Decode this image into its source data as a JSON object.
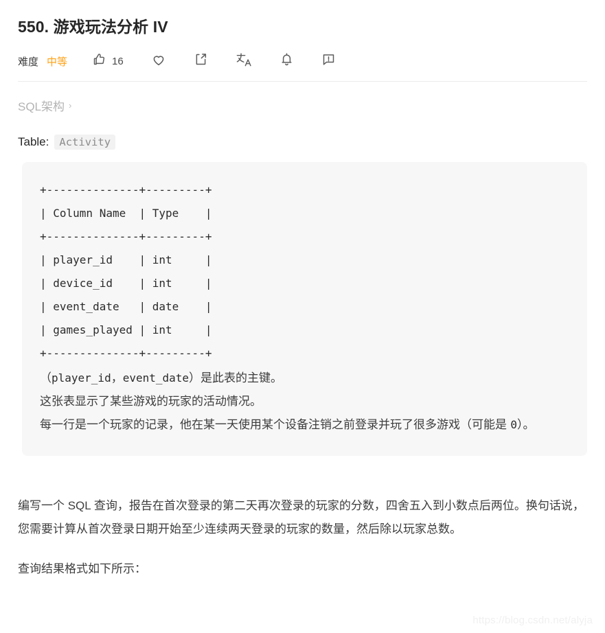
{
  "header": {
    "title": "550. 游戏玩法分析 IV",
    "difficulty_label": "难度",
    "difficulty_value": "中等",
    "difficulty_color": "#ffa116",
    "actions": [
      {
        "name": "like",
        "icon": "thumbs-up-icon",
        "count": "16"
      },
      {
        "name": "favorite",
        "icon": "heart-icon",
        "count": ""
      },
      {
        "name": "share",
        "icon": "share-icon",
        "count": ""
      },
      {
        "name": "translate",
        "icon": "translate-icon",
        "count": ""
      },
      {
        "name": "notify",
        "icon": "bell-icon",
        "count": ""
      },
      {
        "name": "feedback",
        "icon": "feedback-icon",
        "count": ""
      }
    ]
  },
  "breadcrumb": {
    "label": "SQL架构",
    "chevron": "›"
  },
  "schema": {
    "table_label": "Table:",
    "table_name": "Activity",
    "ascii_table": "+--------------+---------+\n| Column Name  | Type    |\n+--------------+---------+\n| player_id    | int     |\n| device_id    | int     |\n| event_date   | date    |\n| games_played | int     |\n+--------------+---------+",
    "notes": [
      {
        "parts": [
          {
            "text": "（",
            "mono": false
          },
          {
            "text": "player_id",
            "mono": true
          },
          {
            "text": "，",
            "mono": false
          },
          {
            "text": "event_date",
            "mono": true
          },
          {
            "text": "）是此表的主键。",
            "mono": false
          }
        ]
      },
      {
        "parts": [
          {
            "text": "这张表显示了某些游戏的玩家的活动情况。",
            "mono": false
          }
        ]
      },
      {
        "parts": [
          {
            "text": "每一行是一个玩家的记录，他在某一天使用某个设备注销之前登录并玩了很多游戏（可能是 ",
            "mono": false
          },
          {
            "text": "0",
            "mono": true
          },
          {
            "text": "）。",
            "mono": false
          }
        ]
      }
    ]
  },
  "body": {
    "problem_statement": "编写一个 SQL 查询，报告在首次登录的第二天再次登录的玩家的分数，四舍五入到小数点后两位。换句话说，您需要计算从首次登录日期开始至少连续两天登录的玩家的数量，然后除以玩家总数。",
    "result_intro": "查询结果格式如下所示："
  },
  "watermark": {
    "text": "https://blog.csdn.net/alyja"
  }
}
